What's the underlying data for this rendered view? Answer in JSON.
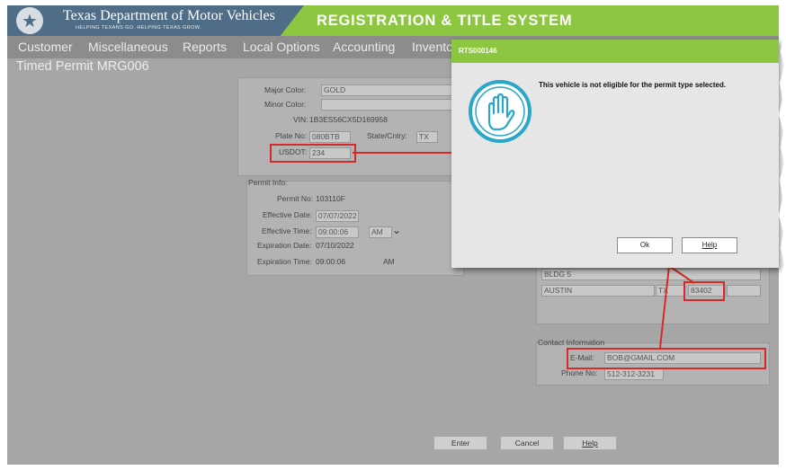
{
  "header": {
    "agency": "Texas Department of Motor Vehicles",
    "tagline": "HELPING TEXANS GO. HELPING TEXAS GROW.",
    "system_title": "REGISTRATION & TITLE SYSTEM"
  },
  "menu": [
    "Customer",
    "Miscellaneous",
    "Reports",
    "Local Options",
    "Accounting",
    "Inventory"
  ],
  "page_title": "Timed Permit MRG006",
  "vehicle": {
    "major_color_label": "Major Color:",
    "major_color": "GOLD",
    "minor_color_label": "Minor Color:",
    "minor_color": "",
    "vin_label": "VIN:",
    "vin": "1B3ES56CX5D169958",
    "plate_label": "Plate No:",
    "plate": "080BTB",
    "state_label": "State/Cntry:",
    "state": "TX",
    "usdot_label": "USDOT:",
    "usdot": "234"
  },
  "permit": {
    "section_label": "Permit Info:",
    "permit_no_label": "Permit No:",
    "permit_no": "103110F",
    "effective_date_label": "Effective Date:",
    "effective_date": "07/07/2022",
    "effective_time_label": "Effective Time:",
    "effective_time": "09:00:06",
    "ampm": "AM",
    "expiration_date_label": "Expiration Date:",
    "expiration_date": "07/10/2022",
    "expiration_time_label": "Expiration Time:",
    "expiration_time": "09:00:06",
    "expiration_ampm": "AM"
  },
  "address": {
    "line2": "BLDG 5",
    "city": "AUSTIN",
    "state": "TX",
    "zip": "83402"
  },
  "contact": {
    "section_label": "Contact Information",
    "email_label": "E-Mail:",
    "email": "BOB@GMAIL.COM",
    "phone_label": "Phone No:",
    "phone": "512-312-3231"
  },
  "buttons": {
    "enter": "Enter",
    "cancel": "Cancel",
    "help": "Help"
  },
  "dialog": {
    "title": "RTS000146",
    "message": "This vehicle is not eligible for the permit type selected.",
    "ok": "Ok",
    "help": "Help",
    "icon": "hand-stop-icon"
  },
  "colors": {
    "accent_green": "#8dc641",
    "header_blue": "#4f6d86",
    "annotation_red": "#d62a2a",
    "icon_teal": "#29a6c9"
  }
}
